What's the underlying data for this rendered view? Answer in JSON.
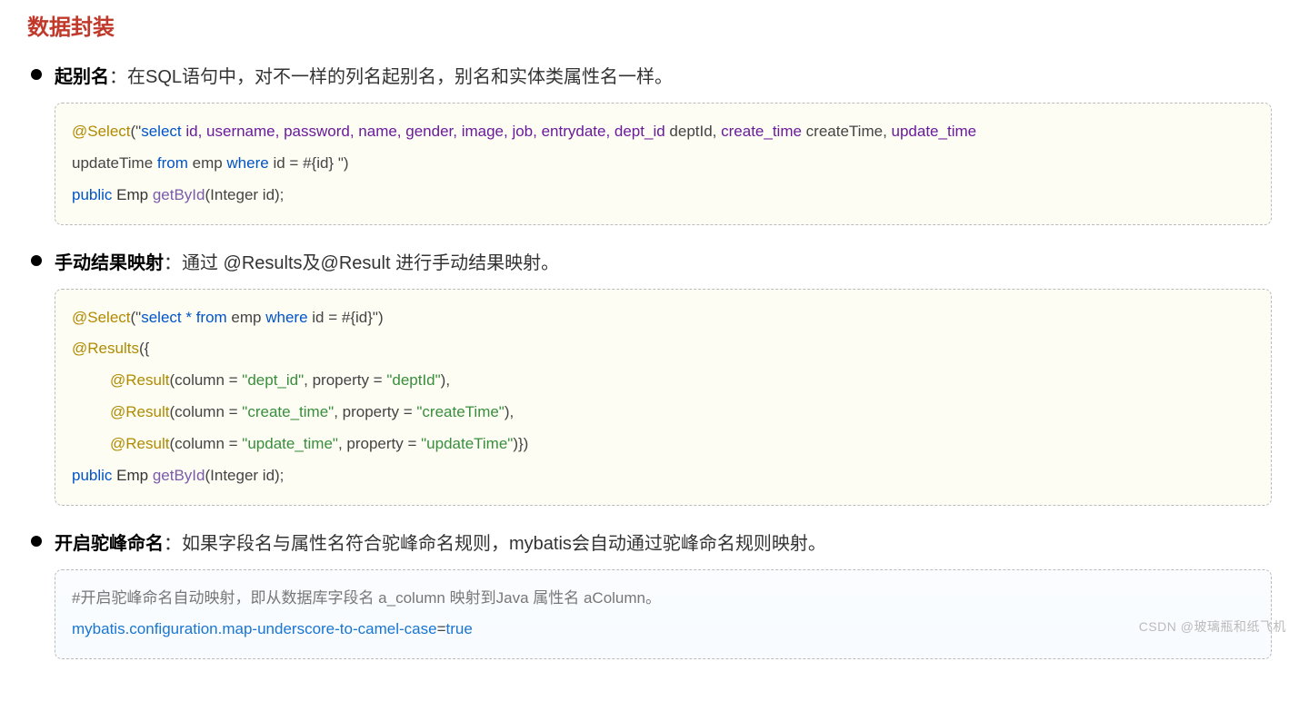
{
  "title": "数据封装",
  "sections": [
    {
      "label": "起别名",
      "desc": "：在SQL语句中，对不一样的列名起别名，别名和实体类属性名一样。",
      "code_kind": "alias"
    },
    {
      "label": "手动结果映射",
      "desc": "：通过 @Results及@Result 进行手动结果映射。",
      "code_kind": "results"
    },
    {
      "label": "开启驼峰命名",
      "desc": "：如果字段名与属性名符合驼峰命名规则，mybatis会自动通过驼峰命名规则映射。",
      "code_kind": "config"
    }
  ],
  "code_alias": {
    "ann": "@Select",
    "open": "(\"",
    "sql_select": "select ",
    "cols1": "id, username, password, name, gender, image, job, entrydate, dept_id ",
    "alias1": "deptId, ",
    "col2": "create_time ",
    "alias2": "createTime, ",
    "col3": "update_time",
    "line2_alias": "updateTime ",
    "from": "from ",
    "tbl": "emp ",
    "where": "where ",
    "idcol": "id ",
    "eq": "= ",
    "param": "#{id} ",
    "close": "\")",
    "sig_public": "public ",
    "sig_type": "Emp ",
    "sig_method": "getById",
    "sig_args": "(Integer id);"
  },
  "code_results": {
    "ann_select": "@Select",
    "sel_open": "(\"",
    "sel_sql_a": "select * from ",
    "sel_tbl": "emp ",
    "sel_where": "where ",
    "sel_id": "id ",
    "sel_eq": "= ",
    "sel_param": "#{id}",
    "sel_close": "\")",
    "ann_results": "@Results",
    "res_open": "({",
    "ann_result": "@Result",
    "r1_col": "(column = ",
    "r1_colv": "\"dept_id\"",
    "r1_prop": ", property = ",
    "r1_propv": "\"deptId\"",
    "r1_end": "),",
    "r2_colv": "\"create_time\"",
    "r2_propv": "\"createTime\"",
    "r2_end": "),",
    "r3_colv": "\"update_time\"",
    "r3_propv": "\"updateTime\"",
    "r3_end": ")})",
    "sig_public": "public ",
    "sig_type": "Emp ",
    "sig_method": "getById",
    "sig_args": "(Integer id);"
  },
  "code_config": {
    "comment": "#开启驼峰命名自动映射，即从数据库字段名 a_column 映射到Java 属性名 aColumn。",
    "key": "mybatis.configuration.map-underscore-to-camel-case",
    "eq": "=",
    "val": "true"
  },
  "watermark": "CSDN @玻璃瓶和纸飞机"
}
